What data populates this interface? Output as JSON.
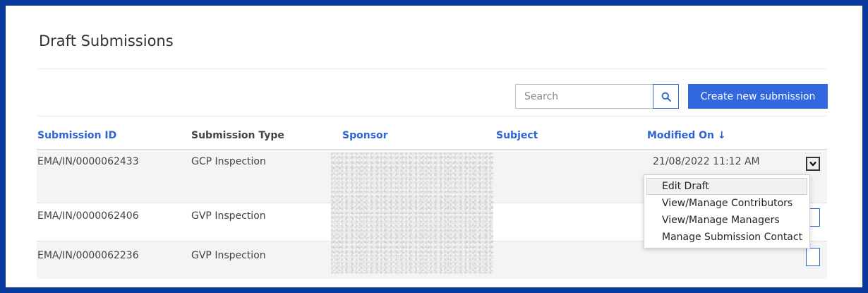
{
  "page": {
    "title": "Draft Submissions"
  },
  "toolbar": {
    "search_placeholder": "Search",
    "search_icon": "search-icon",
    "create_label": "Create new submission"
  },
  "table": {
    "columns": [
      {
        "label": "Submission ID",
        "sortable": true
      },
      {
        "label": "Submission Type",
        "sortable": false
      },
      {
        "label": "Sponsor",
        "sortable": true
      },
      {
        "label": "Subject",
        "sortable": true
      },
      {
        "label": "Modified On ↓",
        "sortable": true
      }
    ],
    "rows": [
      {
        "id": "EMA/IN/0000062433",
        "type": "GCP Inspection",
        "sponsor": "",
        "subject": "",
        "modified": "21/08/2022 11:12 AM"
      },
      {
        "id": "EMA/IN/0000062406",
        "type": "GVP Inspection",
        "sponsor": "",
        "subject": "",
        "modified": ""
      },
      {
        "id": "EMA/IN/0000062236",
        "type": "GVP Inspection",
        "sponsor": "",
        "subject": "",
        "modified": ""
      }
    ]
  },
  "row_menu": {
    "icon": "chevron-down-icon",
    "items": [
      {
        "label": "Edit Draft",
        "hovered": true
      },
      {
        "label": "View/Manage Contributors"
      },
      {
        "label": "View/Manage Managers"
      },
      {
        "label": "Manage Submission Contact"
      }
    ]
  },
  "colors": {
    "frame": "#0b3a9e",
    "accent": "#3168e0",
    "link": "#2f63d4"
  }
}
